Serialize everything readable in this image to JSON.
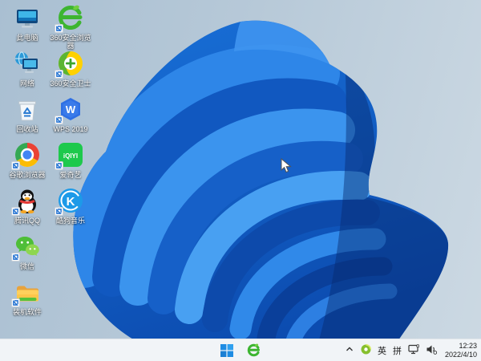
{
  "desktop": {
    "icons": [
      {
        "label": "此电脑",
        "shortcut": false
      },
      {
        "label": "360安全浏览器",
        "shortcut": true
      },
      {
        "label": "网络",
        "shortcut": false
      },
      {
        "label": "360安全卫士",
        "shortcut": true
      },
      {
        "label": "回收站",
        "shortcut": false
      },
      {
        "label": "WPS 2019",
        "shortcut": true
      },
      {
        "label": "谷歌浏览器",
        "shortcut": true
      },
      {
        "label": "爱奇艺",
        "shortcut": true
      },
      {
        "label": "腾讯QQ",
        "shortcut": true
      },
      {
        "label": "酷狗音乐",
        "shortcut": true
      },
      {
        "label": "微信",
        "shortcut": true
      },
      {
        "label": "装机软件",
        "shortcut": true
      }
    ]
  },
  "taskbar": {
    "tray": {
      "ime_mode": "英",
      "ime_method": "拼",
      "time": "12:23",
      "date": "2022/4/10"
    }
  },
  "colors": {
    "background_top": "#a9bfd2",
    "background_bottom": "#ccd9e3",
    "bloom_base": "#1261cd",
    "bloom_highlight": "#3b94ee",
    "bloom_shadow": "#0a3f9a",
    "taskbar_bg": "#f1f4f7",
    "start_blue": "#1e8ce3"
  }
}
